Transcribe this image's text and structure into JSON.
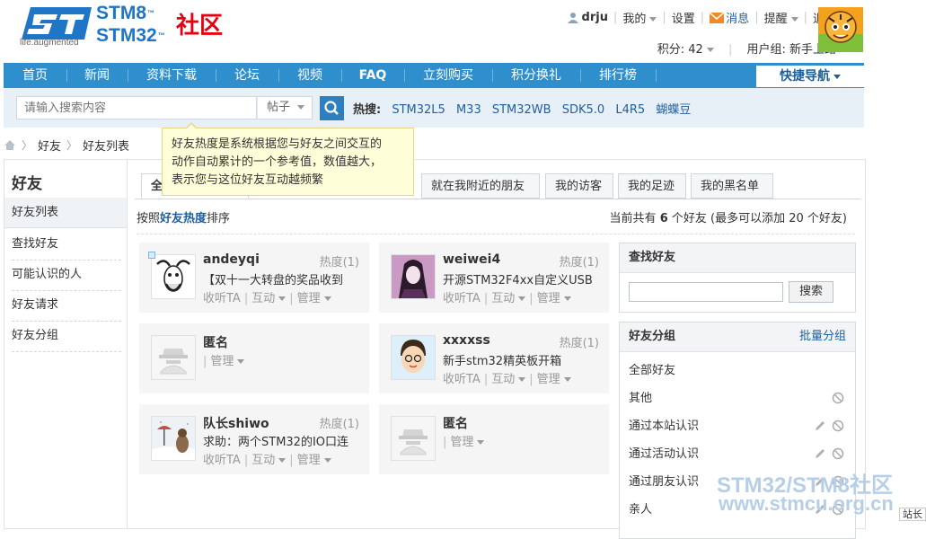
{
  "logo": {
    "brand1": "STM8",
    "brand2": "STM32",
    "tm": "™",
    "community": "社区",
    "tagline": "life.augmented"
  },
  "header": {
    "username": "drju",
    "my": "我的",
    "settings": "设置",
    "messages": "消息",
    "reminders": "提醒",
    "logout": "退出",
    "points": "积分: 42",
    "usergroup": "用户组: 新手上路"
  },
  "nav": {
    "items": [
      "首页",
      "新闻",
      "资料下载",
      "论坛",
      "视频",
      "FAQ",
      "立刻购买",
      "积分换礼",
      "排行榜"
    ],
    "quick": "快捷导航"
  },
  "search": {
    "placeholder": "请输入搜索内容",
    "type": "帖子",
    "hot_label": "热搜:",
    "hot_keywords": [
      "STM32L5",
      "M33",
      "STM32WB",
      "SDK5.0",
      "L4R5",
      "蝴蝶豆"
    ]
  },
  "breadcrumb": {
    "item1": "好友",
    "item2": "好友列表"
  },
  "sidebar": {
    "title": "好友",
    "items": [
      "好友列表",
      "查找好友",
      "可能认识的人",
      "好友请求",
      "好友分组"
    ]
  },
  "tabs": [
    "全部好友",
    "就在我附近的朋友",
    "我的访客",
    "我的足迹",
    "我的黑名单"
  ],
  "sort": {
    "prefix": "按照",
    "key": "好友热度",
    "suffix": "排序"
  },
  "count": {
    "prefix": "当前共有",
    "num": "6",
    "mid": "个好友 (最多可以添加",
    "max": "20",
    "suffix": "个好友)"
  },
  "friends": [
    {
      "name": "andeyqi",
      "heat": "热度(1)",
      "msg": "【双十一大转盘的奖品收到",
      "follow": "收听TA",
      "interact": "互动",
      "manage": "管理"
    },
    {
      "name": "weiwei4",
      "heat": "热度(1)",
      "msg": "开源STM32F4xx自定义USB",
      "follow": "收听TA",
      "interact": "互动",
      "manage": "管理"
    },
    {
      "name": "匿名",
      "manage": "管理"
    },
    {
      "name": "xxxxss",
      "heat": "热度(1)",
      "msg": "新手stm32精英板开箱",
      "follow": "收听TA",
      "interact": "互动",
      "manage": "管理"
    },
    {
      "name": "队长shiwo",
      "heat": "热度(1)",
      "msg": "求助：两个STM32的IO口连",
      "follow": "收听TA",
      "interact": "互动",
      "manage": "管理"
    },
    {
      "name": "匿名",
      "manage": "管理"
    }
  ],
  "find_box": {
    "title": "查找好友",
    "button": "搜索"
  },
  "group_box": {
    "title": "好友分组",
    "batch": "批量分组",
    "groups": [
      "全部好友",
      "其他",
      "通过本站认识",
      "通过活动认识",
      "通过朋友认识",
      "亲人"
    ]
  },
  "tooltip": {
    "text1": "好友热度是系统根据您与好友之间交互的",
    "text2": "动作自动累计的一个参考值，数值越大，",
    "text3": "表示您与这位好友互动越频繁"
  },
  "watermark": {
    "line1": "STM32/STM8社区",
    "line2": "www.stmcu.org.cn"
  },
  "edge_widget": "站长",
  "colors": {
    "nav_blue": "#2e8fcc",
    "link_blue": "#1f5fa0",
    "logo_red": "#e60012",
    "tooltip_bg": "#fefed9"
  }
}
